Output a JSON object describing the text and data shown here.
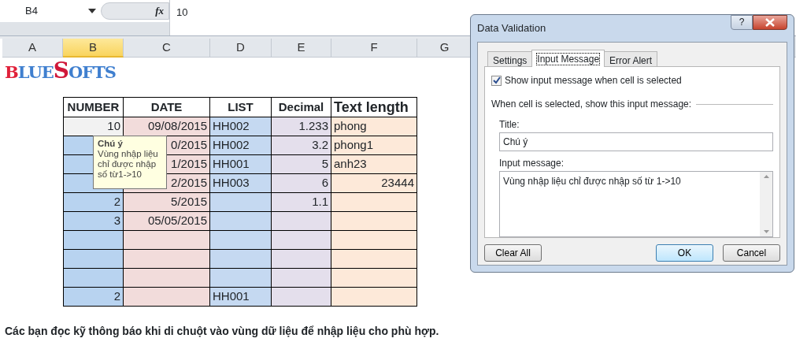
{
  "formula_bar": {
    "name_box": "B4",
    "fx_symbol": "fx",
    "formula": "10"
  },
  "columns": [
    {
      "label": "A",
      "selected": false
    },
    {
      "label": "B",
      "selected": true
    },
    {
      "label": "C",
      "selected": false
    },
    {
      "label": "D",
      "selected": false
    },
    {
      "label": "E",
      "selected": false
    },
    {
      "label": "F",
      "selected": false
    },
    {
      "label": "G",
      "selected": false
    }
  ],
  "logo": "BLUESOFTS",
  "table": {
    "headers": [
      "NUMBER",
      "DATE",
      "LIST",
      "Decimal",
      "Text length"
    ],
    "rows": [
      {
        "active": true,
        "cells": [
          "10",
          "09/08/2015",
          "HH002",
          "1.233",
          "phong"
        ]
      },
      {
        "active": false,
        "cells": [
          "",
          "0/2015",
          "HH002",
          "3.2",
          "phong1"
        ]
      },
      {
        "active": false,
        "cells": [
          "",
          "1/2015",
          "HH001",
          "5",
          "anh23"
        ]
      },
      {
        "active": false,
        "cells": [
          "",
          "2/2015",
          "HH003",
          "6",
          "23444"
        ]
      },
      {
        "active": false,
        "cells": [
          "2",
          "5/2015",
          "",
          "1.1",
          ""
        ]
      },
      {
        "active": false,
        "cells": [
          "3",
          "05/05/2015",
          "",
          "",
          ""
        ]
      },
      {
        "active": false,
        "cells": [
          "",
          "",
          "",
          "",
          ""
        ]
      },
      {
        "active": false,
        "cells": [
          "",
          "",
          "",
          "",
          ""
        ]
      },
      {
        "active": false,
        "cells": [
          "",
          "",
          "",
          "",
          ""
        ]
      },
      {
        "active": false,
        "cells": [
          "2",
          "",
          "HH001",
          "",
          ""
        ]
      }
    ]
  },
  "tooltip": {
    "title": "Chú ý",
    "text": "Vùng nhập liệu\nchỉ được nhập\nsố từ1->10"
  },
  "note": "Các bạn đọc kỹ thông báo khi di chuột vào vùng dữ liệu để nhập liệu cho phù hợp.",
  "dialog": {
    "title": "Data Validation",
    "help_symbol": "?",
    "tabs": [
      {
        "label": "Settings",
        "selected": false
      },
      {
        "label": "Input Message",
        "selected": true
      },
      {
        "label": "Error Alert",
        "selected": false
      }
    ],
    "checkbox": {
      "label": "Show input message when cell is selected",
      "checked": true
    },
    "group_label": "When cell is selected, show this input message:",
    "title_label": "Title:",
    "title_value": "Chú ý",
    "message_label": "Input message:",
    "message_value": "Vùng nhập liệu chỉ được nhập số từ 1->10",
    "buttons": [
      {
        "label": "Clear All",
        "default": false
      },
      {
        "label": "OK",
        "default": true
      },
      {
        "label": "Cancel",
        "default": false
      }
    ]
  }
}
